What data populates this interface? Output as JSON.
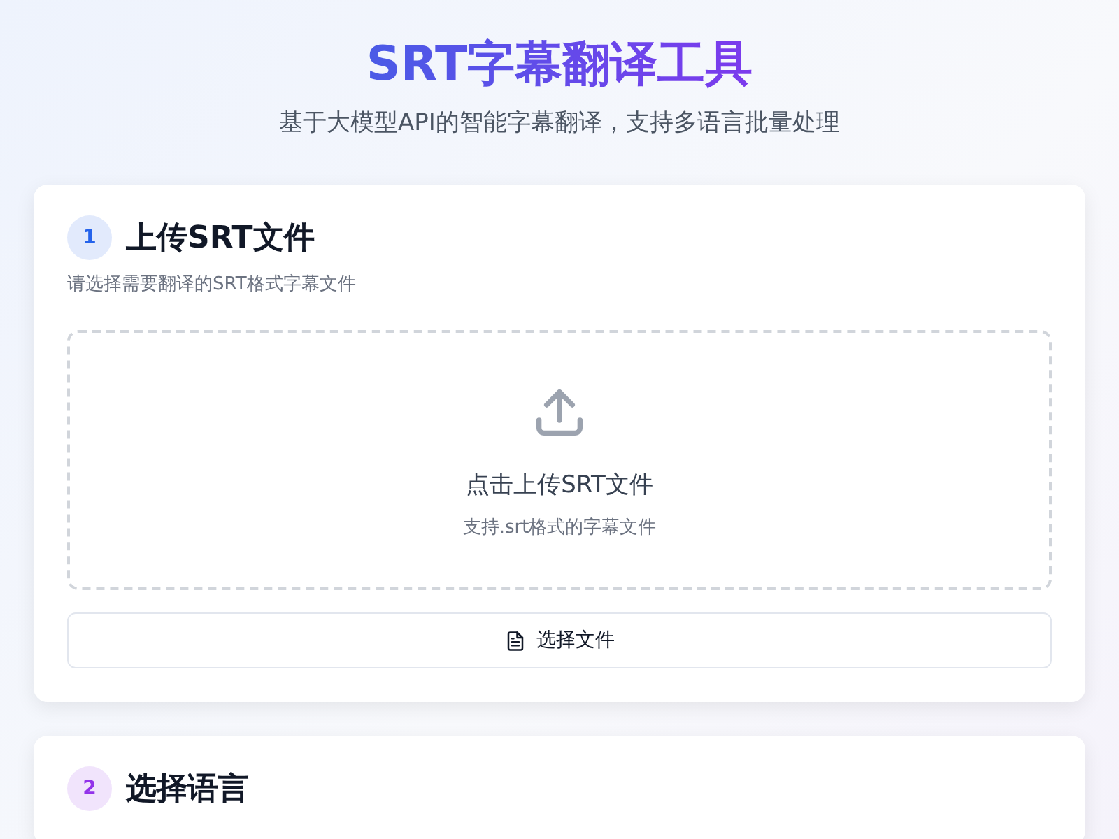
{
  "header": {
    "title": "SRT字幕翻译工具",
    "subtitle": "基于大模型API的智能字幕翻译，支持多语言批量处理"
  },
  "steps": [
    {
      "number": "1",
      "title": "上传SRT文件",
      "color": "#2563eb",
      "description": "请选择需要翻译的SRT格式字幕文件",
      "upload": {
        "prompt": "点击上传SRT文件",
        "hint": "支持.srt格式的字幕文件",
        "button": "选择文件"
      }
    },
    {
      "number": "2",
      "title": "选择语言",
      "color": "#9333ea"
    }
  ]
}
